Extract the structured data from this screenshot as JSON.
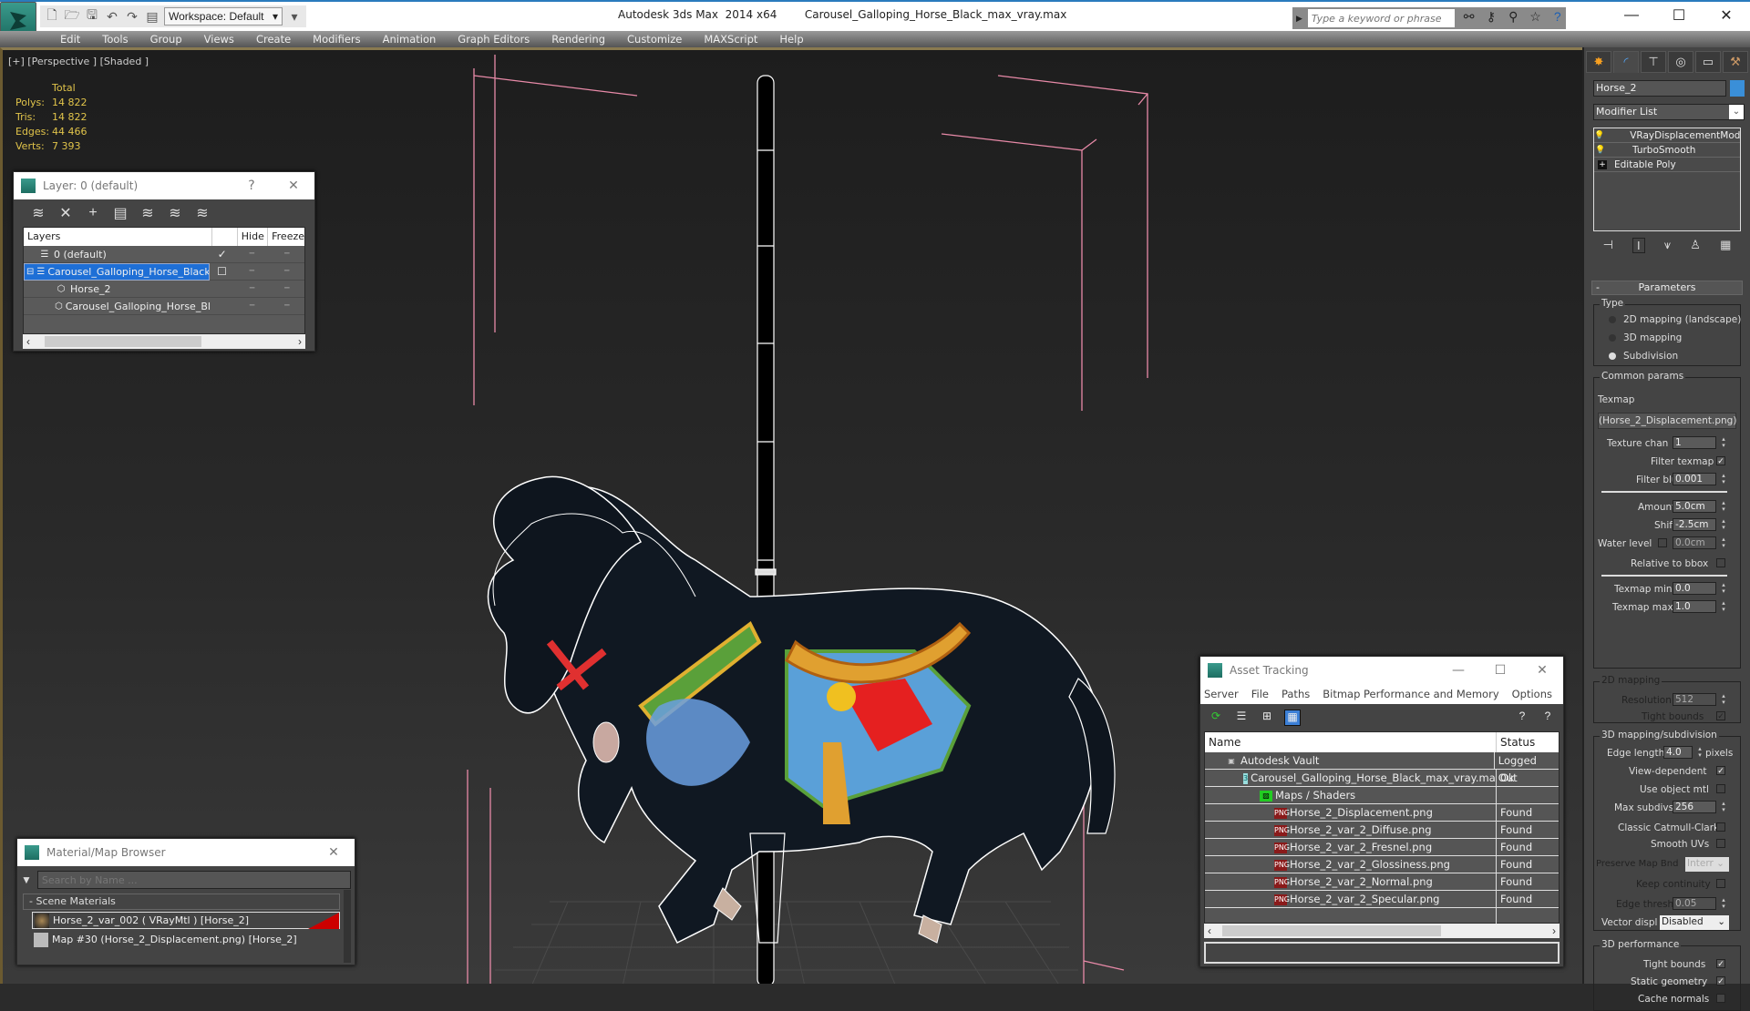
{
  "titlebar": {
    "app_title": "Autodesk 3ds Max  2014 x64",
    "file_name": "Carousel_Galloping_Horse_Black_max_vray.max",
    "workspace": "Workspace: Default",
    "search_placeholder": "Type a keyword or phrase",
    "quick_access_icons": [
      "new-file-icon",
      "open-file-icon",
      "save-icon",
      "undo-icon",
      "redo-icon",
      "project-folder-icon"
    ],
    "search_icons": [
      "binoculars-icon",
      "key-icon",
      "satellite-icon",
      "star-icon",
      "help-icon"
    ],
    "window_controls": [
      "minimize",
      "maximize",
      "close"
    ]
  },
  "menubar": [
    "Edit",
    "Tools",
    "Group",
    "Views",
    "Create",
    "Modifiers",
    "Animation",
    "Graph Editors",
    "Rendering",
    "Customize",
    "MAXScript",
    "Help"
  ],
  "viewport": {
    "label": "[+] [Perspective ] [Shaded ]",
    "stats": {
      "header": "Total",
      "rows": [
        {
          "key": "Polys:",
          "value": "14 822"
        },
        {
          "key": "Tris:",
          "value": "14 822"
        },
        {
          "key": "Edges:",
          "value": "44 466"
        },
        {
          "key": "Verts:",
          "value": "7 393"
        }
      ]
    }
  },
  "layer_window": {
    "title": "Layer: 0 (default)",
    "help": "?",
    "close": "✕",
    "columns": [
      "Layers",
      "",
      "Hide",
      "Freeze"
    ],
    "rows": [
      {
        "name": "0 (default)",
        "indent": 1,
        "check": "✓",
        "selected": false,
        "type": "layer"
      },
      {
        "name": "Carousel_Galloping_Horse_Black",
        "indent": 0,
        "check": "☐",
        "selected": true,
        "type": "layer"
      },
      {
        "name": "Horse_2",
        "indent": 2,
        "check": "",
        "selected": false,
        "type": "object"
      },
      {
        "name": "Carousel_Galloping_Horse_Black",
        "indent": 2,
        "check": "",
        "selected": false,
        "type": "object"
      }
    ]
  },
  "material_browser": {
    "title": "Material/Map Browser",
    "search_placeholder": "Search by Name ...",
    "group": "- Scene Materials",
    "items": [
      {
        "label": "Horse_2_var_002  ( VRayMtl ) [Horse_2]",
        "selected": true
      },
      {
        "label": "Map #30 (Horse_2_Displacement.png) [Horse_2]",
        "selected": false
      }
    ]
  },
  "asset_tracking": {
    "title": "Asset Tracking",
    "menu": [
      "Server",
      "File",
      "Paths",
      "Bitmap Performance and Memory",
      "Options"
    ],
    "columns": [
      "Name",
      "Status"
    ],
    "rows": [
      {
        "name": "Autodesk Vault",
        "status": "Logged Out",
        "indent": 1,
        "icon": "vault"
      },
      {
        "name": "Carousel_Galloping_Horse_Black_max_vray.max",
        "status": "Ok",
        "indent": 2,
        "icon": "max"
      },
      {
        "name": "Maps / Shaders",
        "status": "",
        "indent": 3,
        "icon": "maps"
      },
      {
        "name": "Horse_2_Displacement.png",
        "status": "Found",
        "indent": 4,
        "icon": "png"
      },
      {
        "name": "Horse_2_var_2_Diffuse.png",
        "status": "Found",
        "indent": 4,
        "icon": "png"
      },
      {
        "name": "Horse_2_var_2_Fresnel.png",
        "status": "Found",
        "indent": 4,
        "icon": "png"
      },
      {
        "name": "Horse_2_var_2_Glossiness.png",
        "status": "Found",
        "indent": 4,
        "icon": "png"
      },
      {
        "name": "Horse_2_var_2_Normal.png",
        "status": "Found",
        "indent": 4,
        "icon": "png"
      },
      {
        "name": "Horse_2_var_2_Specular.png",
        "status": "Found",
        "indent": 4,
        "icon": "png"
      }
    ]
  },
  "command_panel": {
    "object_name": "Horse_2",
    "object_color": "#3a8fd8",
    "modifier_list": "Modifier List",
    "stack": [
      {
        "label": "VRayDisplacementMod",
        "icon": "bulb"
      },
      {
        "label": "TurboSmooth",
        "icon": "bulb"
      },
      {
        "label": "Editable Poly",
        "icon": "plus"
      }
    ],
    "rollout_title": "Parameters",
    "type_group": "Type",
    "type_options": [
      {
        "label": "2D mapping (landscape)",
        "selected": false
      },
      {
        "label": "3D mapping",
        "selected": false
      },
      {
        "label": "Subdivision",
        "selected": true
      }
    ],
    "common_group": "Common params",
    "texmap_label": "Texmap",
    "texmap_value": "(Horse_2_Displacement.png)",
    "texture_chan_label": "Texture chan",
    "texture_chan": "1",
    "filter_texmap_label": "Filter texmap",
    "filter_texmap": true,
    "filter_blur_label": "Filter blur",
    "filter_blur": "0.001",
    "amount_label": "Amount",
    "amount": "5.0cm",
    "shift_label": "Shift",
    "shift": "-2.5cm",
    "water_level_label": "Water level",
    "water_level": "0.0cm",
    "relative_bbox_label": "Relative to bbox",
    "texmap_min_label": "Texmap min",
    "texmap_min": "0.0",
    "texmap_max_label": "Texmap max",
    "texmap_max": "1.0",
    "mapping2d_group": "2D mapping",
    "resolution_label": "Resolution",
    "resolution": "512",
    "tight_bounds_label": "Tight bounds",
    "mapping3d_group": "3D mapping/subdivision",
    "edge_length_label": "Edge length",
    "edge_length": "4.0",
    "pixels_label": "pixels",
    "view_dependent_label": "View-dependent",
    "use_object_mtl_label": "Use object mtl",
    "max_subdivs_label": "Max subdivs",
    "max_subdivs": "256",
    "classic_cc_label": "Classic Catmull-Clark",
    "smooth_uvs_label": "Smooth UVs",
    "preserve_map_label": "Preserve Map Bnd",
    "preserve_map_value": "Interr",
    "keep_continuity_label": "Keep continuity",
    "edge_thresh_label": "Edge thresh",
    "edge_thresh": "0.05",
    "vector_displ_label": "Vector displ",
    "vector_displ_value": "Disabled",
    "perf_group": "3D performance",
    "perf_tight_bounds_label": "Tight bounds",
    "static_geometry_label": "Static geometry",
    "cache_normals_label": "Cache normals"
  }
}
